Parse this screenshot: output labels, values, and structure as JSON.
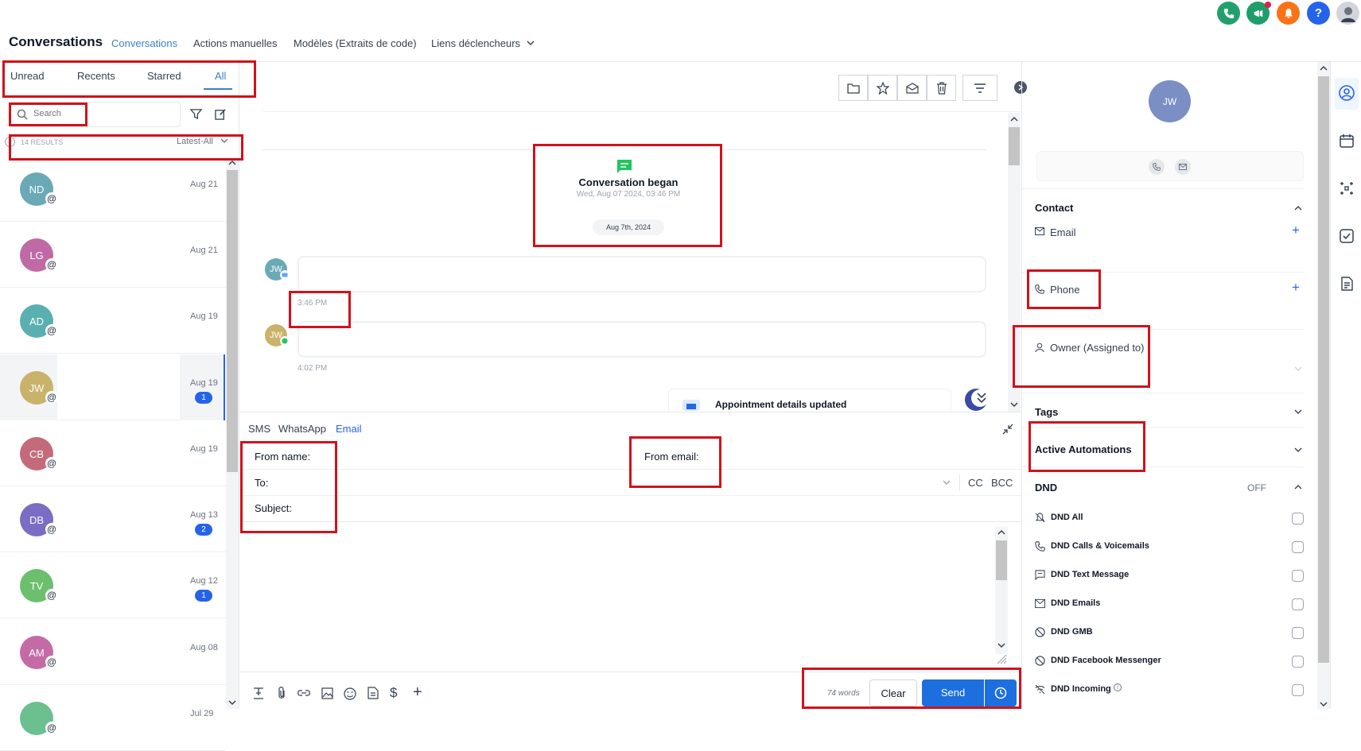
{
  "header": {
    "title": "Conversations",
    "nav": [
      "Conversations",
      "Actions manuelles",
      "Modèles (Extraits de code)",
      "Liens déclencheurs"
    ]
  },
  "colors": {
    "accent": "#3b82c4",
    "send": "#1d6fe0",
    "highlight": "#d0121b"
  },
  "list": {
    "tabs": [
      "Unread",
      "Recents",
      "Starred",
      "All"
    ],
    "search_placeholder": "Search",
    "results": "14 RESULTS",
    "sort": "Latest-All",
    "rows": [
      {
        "initials": "ND",
        "date": "Aug 21",
        "badge": "",
        "color": "#6aa9b6"
      },
      {
        "initials": "LG",
        "date": "Aug 21",
        "badge": "",
        "color": "#c06aa5"
      },
      {
        "initials": "AD",
        "date": "Aug 19",
        "badge": "",
        "color": "#5ab0b0"
      },
      {
        "initials": "JW",
        "date": "Aug 19",
        "badge": "1",
        "color": "#c9b36a"
      },
      {
        "initials": "CB",
        "date": "Aug 19",
        "badge": "",
        "color": "#c46b7b"
      },
      {
        "initials": "DB",
        "date": "Aug 13",
        "badge": "2",
        "color": "#7b6cc4"
      },
      {
        "initials": "TV",
        "date": "Aug 12",
        "badge": "1",
        "color": "#6cbf6c"
      },
      {
        "initials": "AM",
        "date": "Aug 08",
        "badge": "",
        "color": "#c46ba6"
      },
      {
        "initials": "",
        "date": "Jul 29",
        "badge": "",
        "color": "#6cbf8e"
      }
    ]
  },
  "chat": {
    "began_title": "Conversation began",
    "began_time": "Wed, Aug 07 2024, 03:46 PM",
    "date_chip": "Aug 7th, 2024",
    "msg1_avatar": "JW",
    "msg1_time": "3:46 PM",
    "msg2_avatar": "JW",
    "msg2_time": "4:02 PM",
    "appointment": "Appointment details updated"
  },
  "composer": {
    "channels": [
      "SMS",
      "WhatsApp",
      "Email"
    ],
    "from_name": "From name:",
    "from_email": "From email:",
    "to": "To:",
    "subject": "Subject:",
    "cc": "CC",
    "bcc": "BCC",
    "word_count": "74 words",
    "clear": "Clear",
    "send": "Send"
  },
  "contact": {
    "avatar": "JW",
    "section_contact": "Contact",
    "email_label": "Email",
    "phone_label": "Phone",
    "owner_label": "Owner (Assigned to)",
    "tags": "Tags",
    "automations": "Active Automations",
    "dnd": "DND",
    "dnd_state": "OFF",
    "dnd_items": [
      "DND All",
      "DND Calls & Voicemails",
      "DND Text Message",
      "DND Emails",
      "DND GMB",
      "DND Facebook Messenger",
      "DND Incoming"
    ]
  }
}
